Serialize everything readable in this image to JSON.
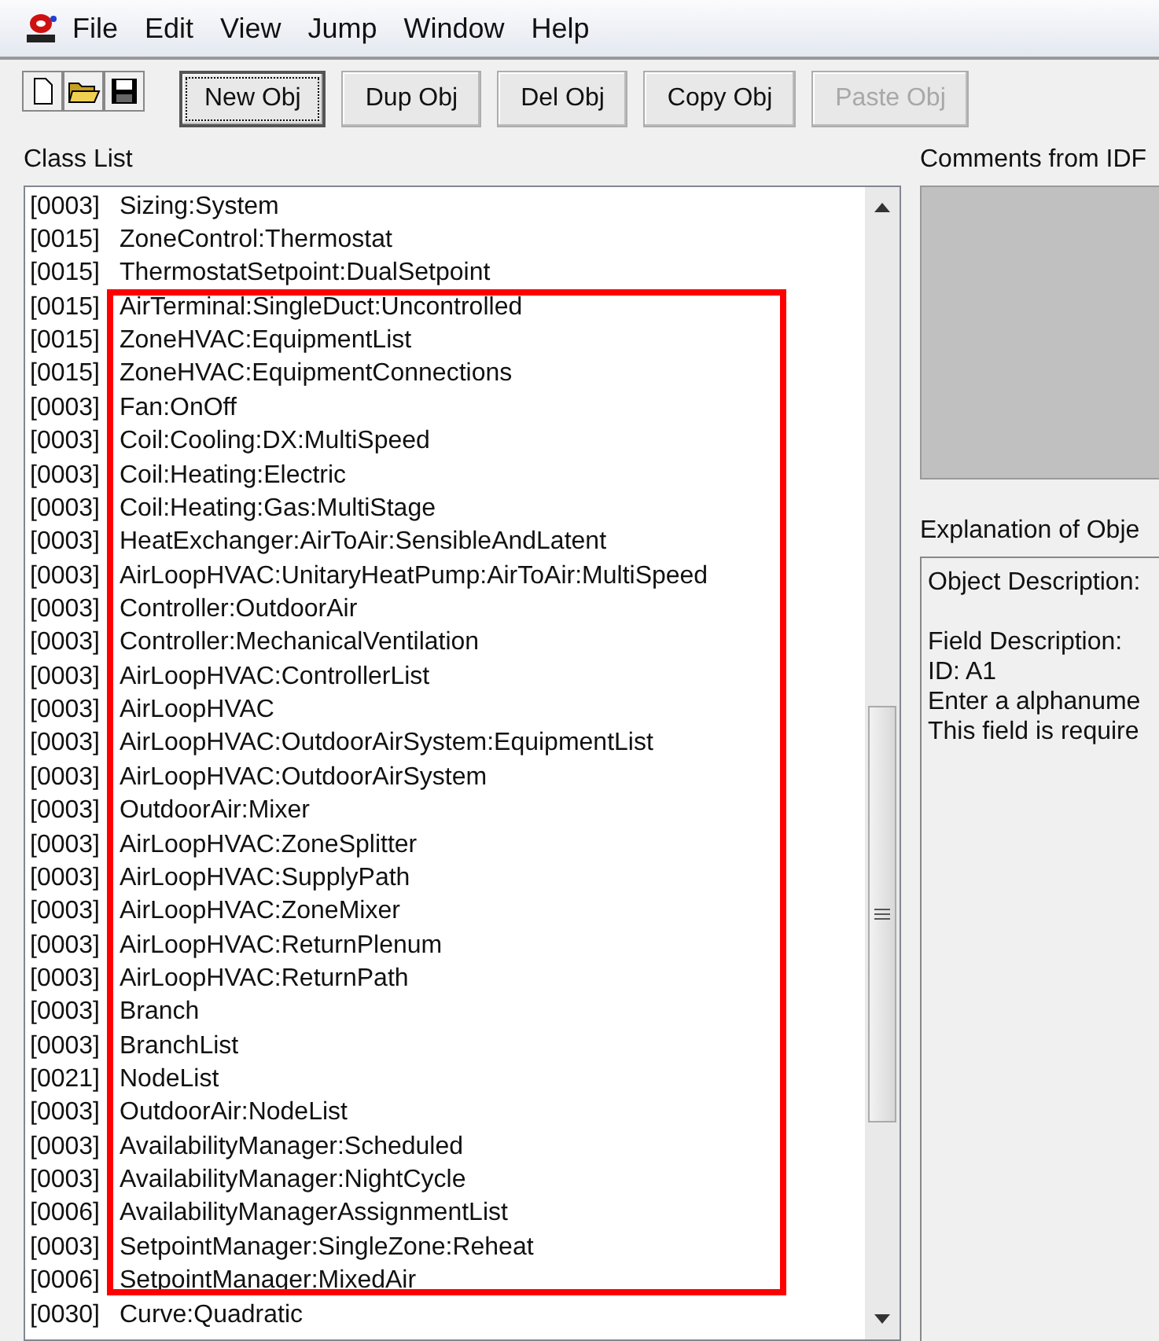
{
  "menu": [
    "File",
    "Edit",
    "View",
    "Jump",
    "Window",
    "Help"
  ],
  "buttons": [
    {
      "label": "New Obj",
      "focused": true,
      "disabled": false
    },
    {
      "label": "Dup Obj",
      "focused": false,
      "disabled": false
    },
    {
      "label": "Del Obj",
      "focused": false,
      "disabled": false
    },
    {
      "label": "Copy Obj",
      "focused": false,
      "disabled": false
    },
    {
      "label": "Paste Obj",
      "focused": false,
      "disabled": true
    }
  ],
  "class_list": {
    "label": "Class List",
    "rows": [
      {
        "count": "[0003]",
        "name": "Sizing:System"
      },
      {
        "count": "[0015]",
        "name": "ZoneControl:Thermostat"
      },
      {
        "count": "[0015]",
        "name": "ThermostatSetpoint:DualSetpoint"
      },
      {
        "count": "[0015]",
        "name": "AirTerminal:SingleDuct:Uncontrolled"
      },
      {
        "count": "[0015]",
        "name": "ZoneHVAC:EquipmentList"
      },
      {
        "count": "[0015]",
        "name": "ZoneHVAC:EquipmentConnections"
      },
      {
        "count": "[0003]",
        "name": "Fan:OnOff"
      },
      {
        "count": "[0003]",
        "name": "Coil:Cooling:DX:MultiSpeed"
      },
      {
        "count": "[0003]",
        "name": "Coil:Heating:Electric"
      },
      {
        "count": "[0003]",
        "name": "Coil:Heating:Gas:MultiStage"
      },
      {
        "count": "[0003]",
        "name": "HeatExchanger:AirToAir:SensibleAndLatent"
      },
      {
        "count": "[0003]",
        "name": "AirLoopHVAC:UnitaryHeatPump:AirToAir:MultiSpeed"
      },
      {
        "count": "[0003]",
        "name": "Controller:OutdoorAir"
      },
      {
        "count": "[0003]",
        "name": "Controller:MechanicalVentilation"
      },
      {
        "count": "[0003]",
        "name": "AirLoopHVAC:ControllerList"
      },
      {
        "count": "[0003]",
        "name": "AirLoopHVAC"
      },
      {
        "count": "[0003]",
        "name": "AirLoopHVAC:OutdoorAirSystem:EquipmentList"
      },
      {
        "count": "[0003]",
        "name": "AirLoopHVAC:OutdoorAirSystem"
      },
      {
        "count": "[0003]",
        "name": "OutdoorAir:Mixer"
      },
      {
        "count": "[0003]",
        "name": "AirLoopHVAC:ZoneSplitter"
      },
      {
        "count": "[0003]",
        "name": "AirLoopHVAC:SupplyPath"
      },
      {
        "count": "[0003]",
        "name": "AirLoopHVAC:ZoneMixer"
      },
      {
        "count": "[0003]",
        "name": "AirLoopHVAC:ReturnPlenum"
      },
      {
        "count": "[0003]",
        "name": "AirLoopHVAC:ReturnPath"
      },
      {
        "count": "[0003]",
        "name": "Branch"
      },
      {
        "count": "[0003]",
        "name": "BranchList"
      },
      {
        "count": "[0021]",
        "name": "NodeList"
      },
      {
        "count": "[0003]",
        "name": "OutdoorAir:NodeList"
      },
      {
        "count": "[0003]",
        "name": "AvailabilityManager:Scheduled"
      },
      {
        "count": "[0003]",
        "name": "AvailabilityManager:NightCycle"
      },
      {
        "count": "[0006]",
        "name": "AvailabilityManagerAssignmentList"
      },
      {
        "count": "[0003]",
        "name": "SetpointManager:SingleZone:Reheat"
      },
      {
        "count": "[0006]",
        "name": "SetpointManager:MixedAir"
      },
      {
        "count": "[0030]",
        "name": "Curve:Quadratic"
      }
    ]
  },
  "comments": {
    "label": "Comments from IDF"
  },
  "explanation": {
    "label": "Explanation of Obje",
    "object_description": "Object Description:",
    "field_lines": [
      "Field Description:",
      "ID: A1",
      "Enter a alphanume",
      "This field is require"
    ]
  }
}
